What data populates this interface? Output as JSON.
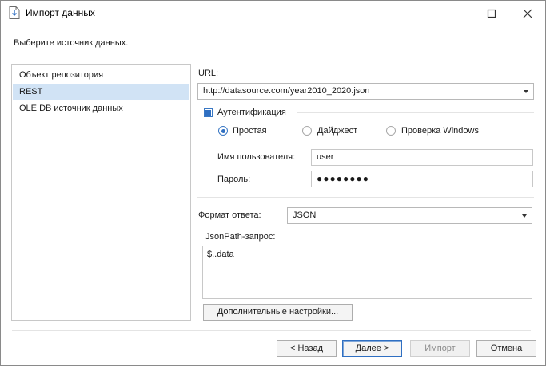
{
  "window": {
    "title": "Импорт данных",
    "minimize_icon": "minimize-icon",
    "maximize_icon": "maximize-icon",
    "close_icon": "close-icon"
  },
  "prompt": "Выберите источник данных.",
  "sources": [
    {
      "label": "Объект репозитория",
      "selected": false
    },
    {
      "label": "REST",
      "selected": true
    },
    {
      "label": "OLE DB источник данных",
      "selected": false
    }
  ],
  "url": {
    "label": "URL:",
    "value": "http://datasource.com/year2010_2020.json"
  },
  "auth": {
    "label": "Аутентификация",
    "checked": true,
    "options": [
      {
        "label": "Простая",
        "selected": true
      },
      {
        "label": "Дайджест",
        "selected": false
      },
      {
        "label": "Проверка Windows",
        "selected": false
      }
    ],
    "username_label": "Имя пользователя:",
    "username_value": "user",
    "password_label": "Пароль:",
    "password_value": "●●●●●●●●"
  },
  "response_format": {
    "label": "Формат ответа:",
    "value": "JSON"
  },
  "jsonpath": {
    "label": "JsonPath-запрос:",
    "value": "$..data"
  },
  "buttons": {
    "advanced": "Дополнительные настройки...",
    "back": "< Назад",
    "next": "Далее >",
    "import": "Импорт",
    "cancel": "Отмена"
  },
  "colors": {
    "selection": "#d1e3f5",
    "accent": "#2f6fc2"
  }
}
